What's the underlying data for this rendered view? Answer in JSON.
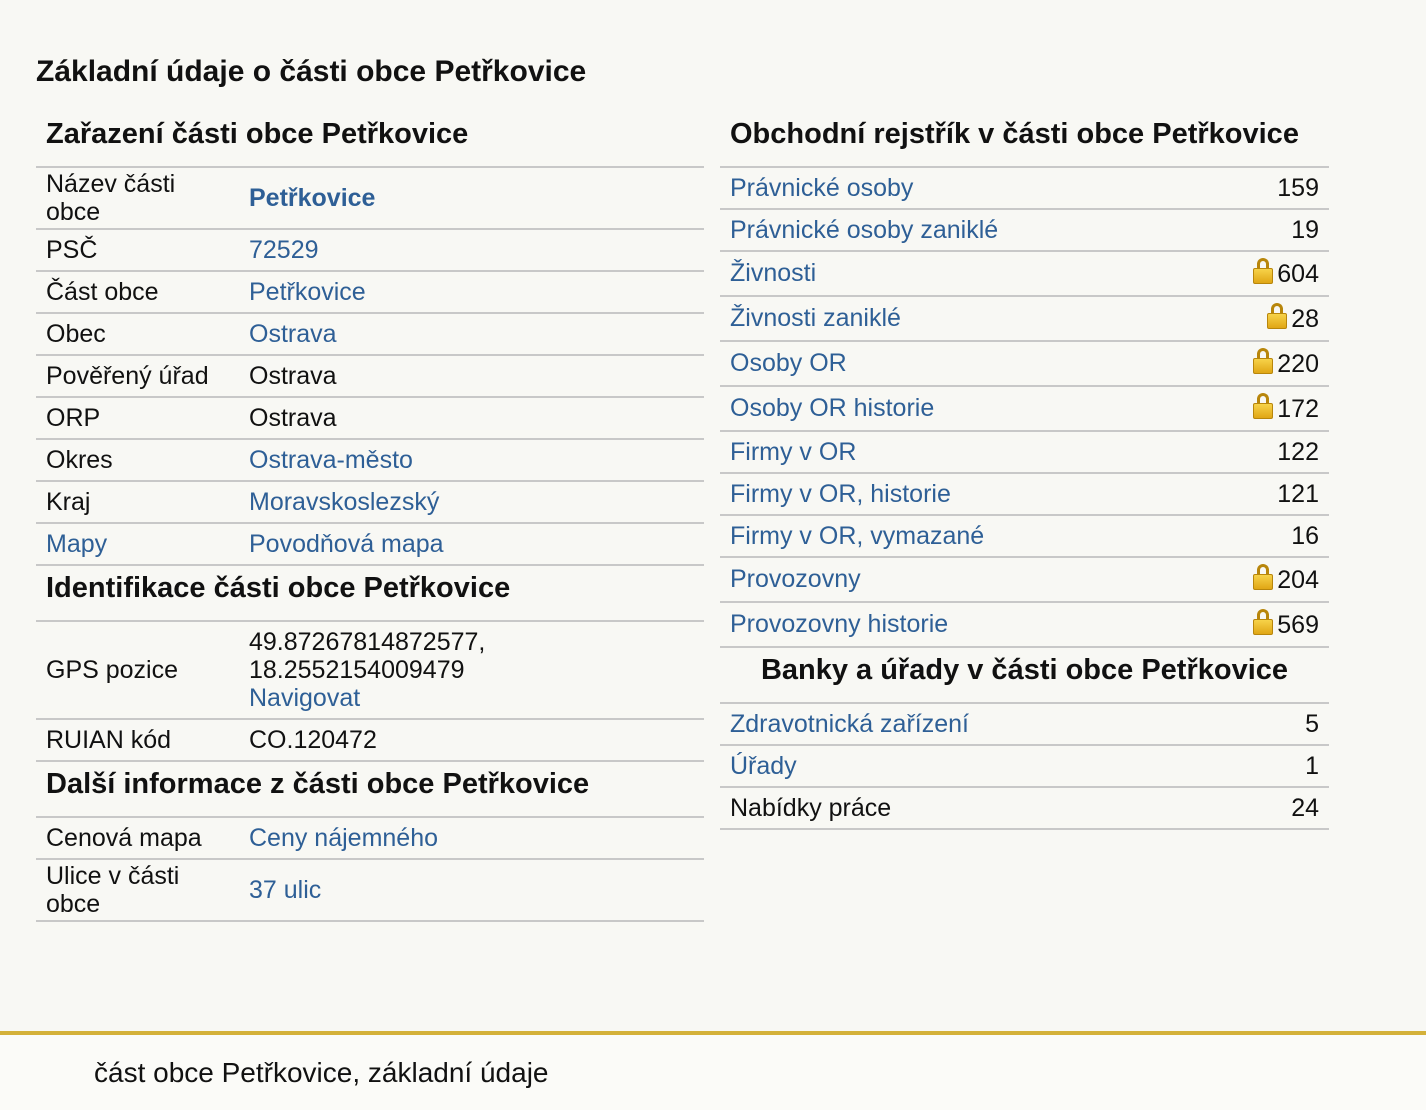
{
  "title": "Základní údaje o části obce Petřkovice",
  "zarazeni": {
    "heading": "Zařazení části obce Petřkovice",
    "rows": [
      {
        "label": "Název části obce",
        "value": "Petřkovice"
      },
      {
        "label": "PSČ",
        "value": "72529"
      },
      {
        "label": "Část obce",
        "value": "Petřkovice"
      },
      {
        "label": "Obec",
        "value": "Ostrava"
      },
      {
        "label": "Pověřený úřad",
        "value": "Ostrava"
      },
      {
        "label": "ORP",
        "value": "Ostrava"
      },
      {
        "label": "Okres",
        "value": "Ostrava-město"
      },
      {
        "label": "Kraj",
        "value": "Moravskoslezský"
      },
      {
        "label": "Mapy",
        "value": "Povodňová mapa"
      }
    ]
  },
  "identifikace": {
    "heading": "Identifikace části obce Petřkovice",
    "gps_label": "GPS pozice",
    "gps_value": "49.87267814872577, 18.2552154009479",
    "gps_link": "Navigovat",
    "ruian_label": "RUIAN kód",
    "ruian_value": "CO.120472"
  },
  "dalsi": {
    "heading": "Další informace z části obce Petřkovice",
    "rows": [
      {
        "label": "Cenová mapa",
        "value": "Ceny nájemného"
      },
      {
        "label": "Ulice v části obce",
        "value": "37 ulic"
      }
    ]
  },
  "rejstrik": {
    "heading": "Obchodní rejstřík v části obce Petřkovice",
    "rows": [
      {
        "label": "Právnické osoby",
        "value": "159",
        "locked": false
      },
      {
        "label": "Právnické osoby zaniklé",
        "value": "19",
        "locked": false
      },
      {
        "label": "Živnosti",
        "value": "604",
        "locked": true
      },
      {
        "label": "Živnosti zaniklé",
        "value": "28",
        "locked": true
      },
      {
        "label": "Osoby OR",
        "value": "220",
        "locked": true
      },
      {
        "label": "Osoby OR historie",
        "value": "172",
        "locked": true
      },
      {
        "label": "Firmy v OR",
        "value": "122",
        "locked": false
      },
      {
        "label": "Firmy v OR, historie",
        "value": "121",
        "locked": false
      },
      {
        "label": "Firmy v OR, vymazané",
        "value": "16",
        "locked": false
      },
      {
        "label": "Provozovny",
        "value": "204",
        "locked": true
      },
      {
        "label": "Provozovny historie",
        "value": "569",
        "locked": true
      }
    ]
  },
  "banky": {
    "heading": "Banky a úřady v části obce Petřkovice",
    "rows": [
      {
        "label": "Zdravotnická zařízení",
        "value": "5"
      },
      {
        "label": "Úřady",
        "value": "1"
      },
      {
        "label": "Nabídky práce",
        "value": "24"
      }
    ]
  },
  "footer": {
    "text": "část obce Petřkovice, základní údaje"
  },
  "icons": {
    "lock": "lock-icon"
  },
  "colors": {
    "link": "#2e5f96",
    "footer_border": "#d4b13a",
    "lock": "#e0a615"
  }
}
